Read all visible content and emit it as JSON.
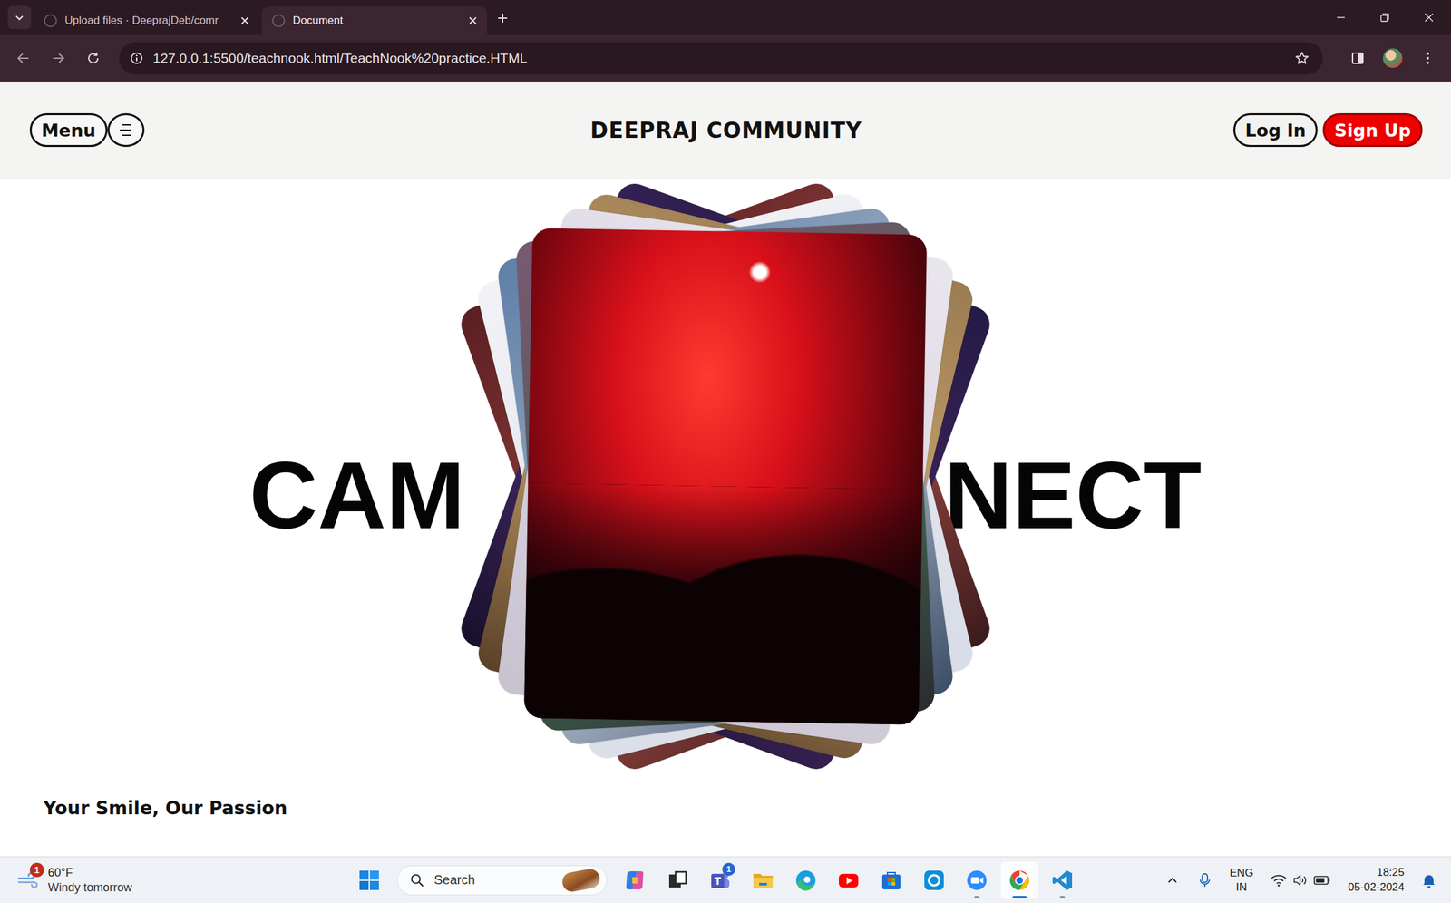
{
  "browser": {
    "tabs": [
      {
        "label": "Upload files · DeeprajDeb/comr",
        "selected": false
      },
      {
        "label": "Document",
        "selected": true
      }
    ],
    "url": "127.0.0.1:5500/teachnook.html/TeachNook%20practice.HTML"
  },
  "page": {
    "header": {
      "menu": "Menu",
      "title": "DEEPRAJ COMMUNITY",
      "login": "Log In",
      "signup": "Sign Up"
    },
    "hero": {
      "left": "CAM",
      "right": "NECT"
    },
    "tagline": "Your Smile, Our Passion"
  },
  "taskbar": {
    "weather": {
      "temp": "60°F",
      "forecast": "Windy tomorrow",
      "badge": "1"
    },
    "search": "Search",
    "apps": [
      {
        "kind": "copilot",
        "running": false,
        "active": false,
        "badge": ""
      },
      {
        "kind": "taskview",
        "running": false,
        "active": false,
        "badge": ""
      },
      {
        "kind": "teams",
        "running": false,
        "active": false,
        "badge": "1"
      },
      {
        "kind": "explorer",
        "running": false,
        "active": false,
        "badge": ""
      },
      {
        "kind": "edge",
        "running": false,
        "active": false,
        "badge": ""
      },
      {
        "kind": "youtube",
        "running": false,
        "active": false,
        "badge": ""
      },
      {
        "kind": "store",
        "running": false,
        "active": false,
        "badge": ""
      },
      {
        "kind": "ring",
        "running": false,
        "active": false,
        "badge": ""
      },
      {
        "kind": "zoom",
        "running": true,
        "active": false,
        "badge": ""
      },
      {
        "kind": "chrome",
        "running": true,
        "active": true,
        "badge": ""
      },
      {
        "kind": "vscode",
        "running": true,
        "active": false,
        "badge": ""
      }
    ],
    "tray": {
      "lang": "ENG",
      "region": "IN",
      "time": "18:25",
      "date": "05-02-2024"
    }
  }
}
